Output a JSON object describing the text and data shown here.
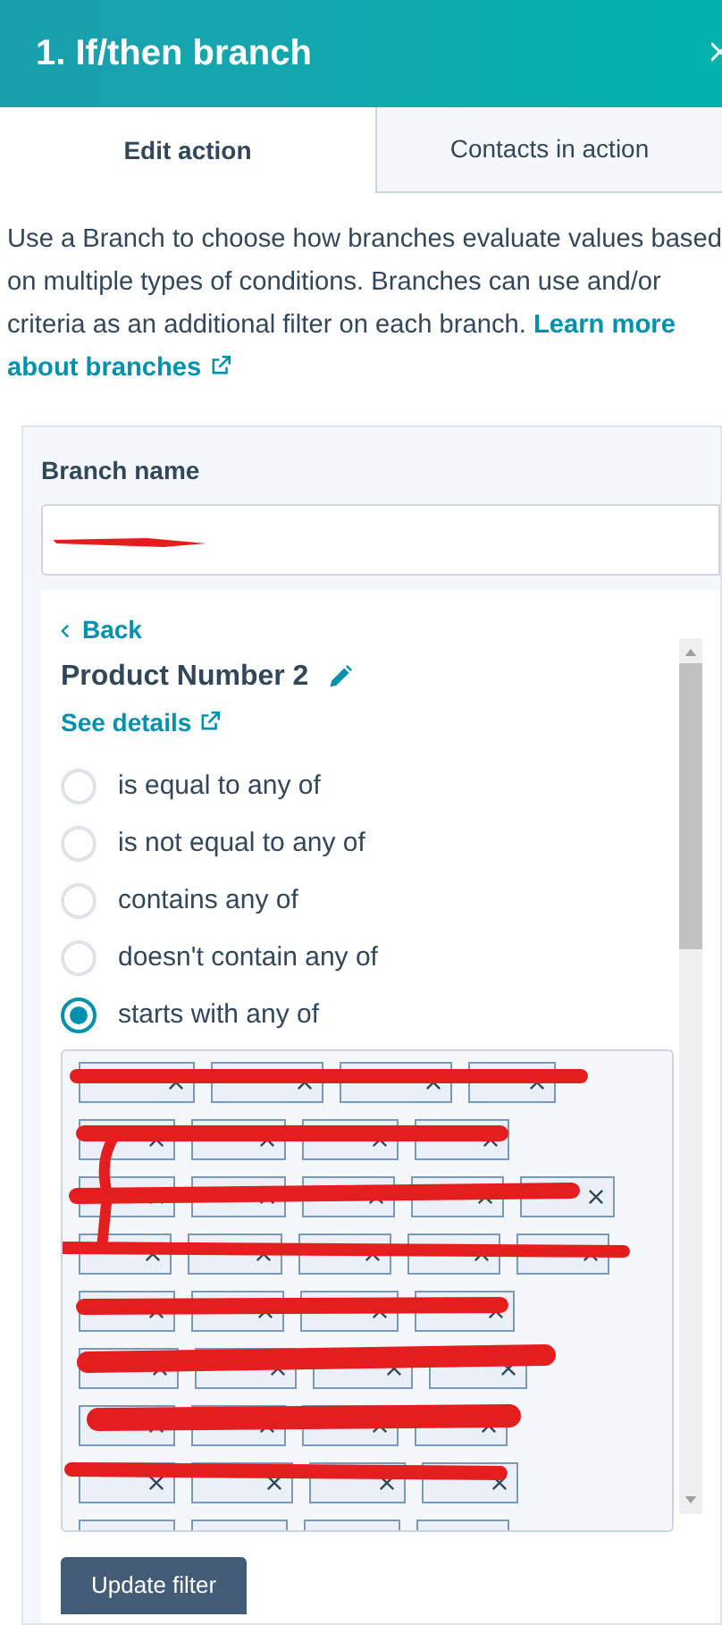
{
  "header": {
    "title": "1. If/then branch"
  },
  "tabs": [
    {
      "label": "Edit action",
      "selected": true
    },
    {
      "label": "Contacts in action",
      "selected": false
    }
  ],
  "description": {
    "text": "Use a Branch to choose how branches evaluate values based on multiple types of conditions. Branches can use and/or criteria as an additional filter on each branch.",
    "link": [
      "Learn more",
      "about branches"
    ]
  },
  "branch_name": {
    "label": "Branch name"
  },
  "filter": {
    "back": "Back",
    "property": "Product Number 2",
    "details_link": "See details",
    "operators": [
      {
        "label": "is equal to any of",
        "selected": false
      },
      {
        "label": "is not equal to any of",
        "selected": false
      },
      {
        "label": "contains any of",
        "selected": false
      },
      {
        "label": "doesn't contain any of",
        "selected": false
      },
      {
        "label": "starts with any of",
        "selected": true
      }
    ],
    "button": "Update filter"
  }
}
